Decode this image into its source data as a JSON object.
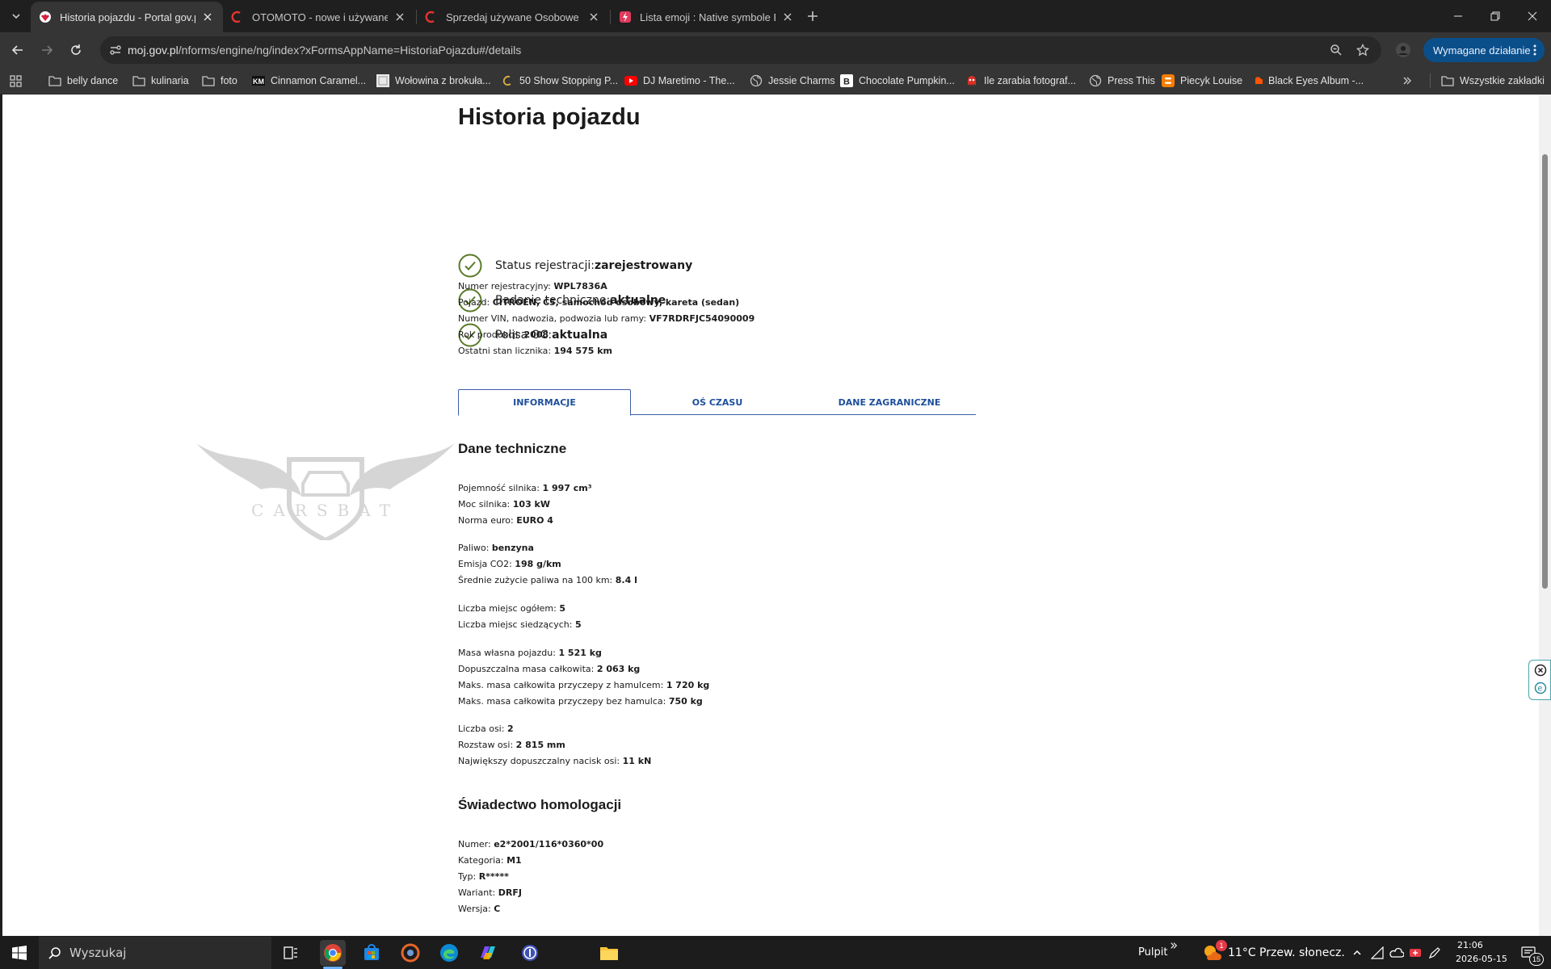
{
  "browser": {
    "tabs": [
      {
        "title": "Historia pojazdu - Portal gov.pl",
        "active": true
      },
      {
        "title": "OTOMOTO - nowe i używane sa",
        "active": false
      },
      {
        "title": "Sprzedaj używane Osobowe | O",
        "active": false
      },
      {
        "title": "Lista emoji : Native symbole Em",
        "active": false
      }
    ],
    "url_host": "moj.gov.pl",
    "url_path": "/nforms/engine/ng/index?xFormsAppName=HistoriaPojazdu#/details",
    "action_button": "Wymagane działanie",
    "bookmarks": [
      {
        "label": "belly dance",
        "icon": "folder-icon"
      },
      {
        "label": "kulinaria",
        "icon": "folder-icon"
      },
      {
        "label": "foto",
        "icon": "folder-icon"
      },
      {
        "label": "Cinnamon Caramel...",
        "icon": "km-icon"
      },
      {
        "label": "Wołowina z brokuła...",
        "icon": "image-icon"
      },
      {
        "label": "50 Show Stopping P...",
        "icon": "c-icon"
      },
      {
        "label": "DJ Maretimo - The...",
        "icon": "youtube-icon"
      },
      {
        "label": "Jessie Charms",
        "icon": "globe-icon"
      },
      {
        "label": "Chocolate Pumpkin...",
        "icon": "b-icon"
      },
      {
        "label": "Ile zarabia fotograf...",
        "icon": "red-icon"
      },
      {
        "label": "Press This",
        "icon": "globe-icon"
      },
      {
        "label": "Piecyk Louise",
        "icon": "blogger-icon"
      },
      {
        "label": "Black Eyes Album -...",
        "icon": "soundcloud-icon"
      }
    ],
    "all_bookmarks": "Wszystkie zakładki"
  },
  "page": {
    "title": "Historia pojazdu",
    "status": [
      {
        "label": "Status rejestracji: ",
        "value": "zarejestrowany"
      },
      {
        "label": "Badanie techniczne: ",
        "value": "aktualne"
      },
      {
        "label": "Polisa OC: ",
        "value": "aktualna"
      }
    ],
    "vehicle": [
      {
        "label": "Numer rejestracyjny: ",
        "value": "WPL7836A"
      },
      {
        "label": "Pojazd: ",
        "value": "CITROEN, C5, samochód osobowy, kareta (sedan)"
      },
      {
        "label": "Numer VIN, nadwozia, podwozia lub ramy: ",
        "value": "VF7RDRFJC54090009"
      },
      {
        "label": "Rok produkcji: ",
        "value": "2008"
      },
      {
        "label": "Ostatni stan licznika: ",
        "value": "194 575 km"
      }
    ],
    "tabs": [
      "INFORMACJE",
      "OŚ CZASU",
      "DANE ZAGRANICZNE"
    ],
    "tech_title": "Dane techniczne",
    "tech_groups": [
      [
        {
          "label": "Pojemność silnika: ",
          "value": "1 997 cm³"
        },
        {
          "label": "Moc silnika: ",
          "value": "103 kW"
        },
        {
          "label": "Norma euro: ",
          "value": "EURO 4"
        }
      ],
      [
        {
          "label": "Paliwo: ",
          "value": "benzyna"
        },
        {
          "label": "Emisja CO2: ",
          "value": "198 g/km"
        },
        {
          "label": "Średnie zużycie paliwa na 100 km: ",
          "value": "8.4 l"
        }
      ],
      [
        {
          "label": "Liczba miejsc ogółem: ",
          "value": "5"
        },
        {
          "label": "Liczba miejsc siedzących: ",
          "value": "5"
        }
      ],
      [
        {
          "label": "Masa własna pojazdu: ",
          "value": "1 521 kg"
        },
        {
          "label": "Dopuszczalna masa całkowita: ",
          "value": "2 063 kg"
        },
        {
          "label": "Maks. masa całkowita przyczepy z hamulcem: ",
          "value": "1 720 kg"
        },
        {
          "label": "Maks. masa całkowita przyczepy bez hamulca: ",
          "value": "750 kg"
        }
      ],
      [
        {
          "label": "Liczba osi: ",
          "value": "2"
        },
        {
          "label": "Rozstaw osi: ",
          "value": "2 815 mm"
        },
        {
          "label": "Największy dopuszczalny nacisk osi: ",
          "value": "11 kN"
        }
      ]
    ],
    "homolog_title": "Świadectwo homologacji",
    "homolog": [
      {
        "label": "Numer: ",
        "value": "e2*2001/116*0360*00"
      },
      {
        "label": "Kategoria: ",
        "value": "M1"
      },
      {
        "label": "Typ: ",
        "value": "R*****"
      },
      {
        "label": "Wariant: ",
        "value": "DRFJ"
      },
      {
        "label": "Wersja: ",
        "value": "C"
      }
    ],
    "watermark": "CARSBAT"
  },
  "taskbar": {
    "search_placeholder": "Wyszukaj",
    "desktop_label": "Pulpit",
    "weather": "11°C  Przew. słonecz.",
    "time": "21:06",
    "date": "2026-05-15",
    "notif_count": "15",
    "weather_badge": "1"
  },
  "colors": {
    "accent_green": "#5b7a2a",
    "tab_blue": "#1d4f9c",
    "action_blue": "#0b4f8a"
  }
}
